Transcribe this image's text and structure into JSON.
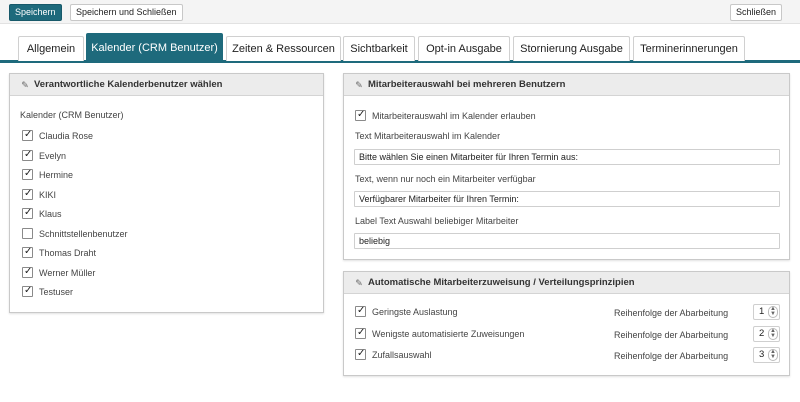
{
  "toolbar": {
    "save_label": "Speichern",
    "save_close_label": "Speichern und Schließen",
    "close_label": "Schließen"
  },
  "tabs": [
    {
      "label": "Allgemein"
    },
    {
      "label": "Kalender (CRM Benutzer)"
    },
    {
      "label": "Zeiten & Ressourcen"
    },
    {
      "label": "Sichtbarkeit"
    },
    {
      "label": "Opt-in Ausgabe"
    },
    {
      "label": "Stornierung Ausgabe"
    },
    {
      "label": "Terminerinnerungen"
    }
  ],
  "colors": {
    "accent": "#1e6a7c"
  },
  "left_panel": {
    "title": "Verantwortliche Kalenderbenutzer wählen",
    "field_label": "Kalender (CRM Benutzer)",
    "users": [
      {
        "name": "Claudia Rose",
        "checked": true
      },
      {
        "name": "Evelyn",
        "checked": true
      },
      {
        "name": "Hermine",
        "checked": true
      },
      {
        "name": "KIKI",
        "checked": true
      },
      {
        "name": "Klaus",
        "checked": true
      },
      {
        "name": "Schnittstellenbenutzer",
        "checked": false
      },
      {
        "name": "Thomas Draht",
        "checked": true
      },
      {
        "name": "Werner Müller",
        "checked": true
      },
      {
        "name": "Testuser",
        "checked": true
      }
    ]
  },
  "right_panel_1": {
    "title": "Mitarbeiterauswahl bei mehreren Benutzern",
    "allow_label": "Mitarbeiterauswahl im Kalender erlauben",
    "text_label": "Text Mitarbeiterauswahl im Kalender",
    "text_value": "Bitte wählen Sie einen Mitarbeiter für Ihren Termin aus:",
    "single_label": "Text, wenn nur noch ein Mitarbeiter verfügbar",
    "single_value": "Verfügbarer Mitarbeiter für Ihren Termin:",
    "any_label": "Label Text Auswahl beliebiger Mitarbeiter",
    "any_value": "beliebig"
  },
  "right_panel_2": {
    "title": "Automatische Mitarbeiterzuweisung / Verteilungsprinzipien",
    "order_label": "Reihenfolge der Abarbeitung",
    "rules": [
      {
        "label": "Geringste Auslastung",
        "order": "1"
      },
      {
        "label": "Wenigste automatisierte Zuweisungen",
        "order": "2"
      },
      {
        "label": "Zufallsauswahl",
        "order": "3"
      }
    ]
  }
}
